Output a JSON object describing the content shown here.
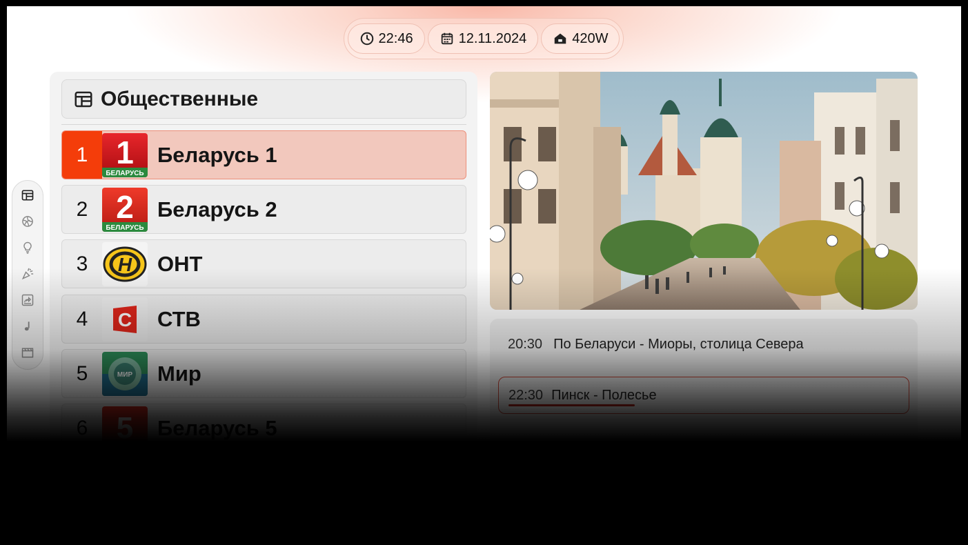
{
  "status_bar": {
    "time": "22:46",
    "date": "12.11.2024",
    "power": "420W",
    "icons": [
      "clock-icon",
      "calendar-icon",
      "home-power-icon"
    ]
  },
  "side_rail": {
    "items": [
      {
        "icon": "tv-guide-icon",
        "active": true
      },
      {
        "icon": "sports-ball-icon"
      },
      {
        "icon": "lightbulb-icon"
      },
      {
        "icon": "party-popper-icon"
      },
      {
        "icon": "kids-toy-icon"
      },
      {
        "icon": "music-note-icon"
      },
      {
        "icon": "movie-clapper-icon"
      }
    ]
  },
  "category": {
    "title": "Общественные",
    "icon": "tv-guide-icon"
  },
  "channels": [
    {
      "number": "1",
      "name": "Беларусь 1",
      "logo_label": "БЕЛАРУСЬ",
      "logo_digit": "1",
      "active": true
    },
    {
      "number": "2",
      "name": "Беларусь 2",
      "logo_label": "БЕЛАРУСЬ",
      "logo_digit": "2"
    },
    {
      "number": "3",
      "name": "ОНТ",
      "logo_digit": "Н"
    },
    {
      "number": "4",
      "name": "СТВ",
      "logo_digit": "С"
    },
    {
      "number": "5",
      "name": "Мир",
      "logo_label": "МИР"
    },
    {
      "number": "6",
      "name": "Беларусь 5",
      "logo_digit": "5"
    }
  ],
  "program_guide": [
    {
      "time": "20:30",
      "title": "По Беларуси - Миоры, столица Севера"
    },
    {
      "time": "22:30",
      "title": "Пинск - Полесье",
      "current": true,
      "progress": 0.31
    }
  ],
  "colors": {
    "accent": "#f43d0a",
    "active_row": "#f2c8bd",
    "progress": "#b8261c"
  }
}
